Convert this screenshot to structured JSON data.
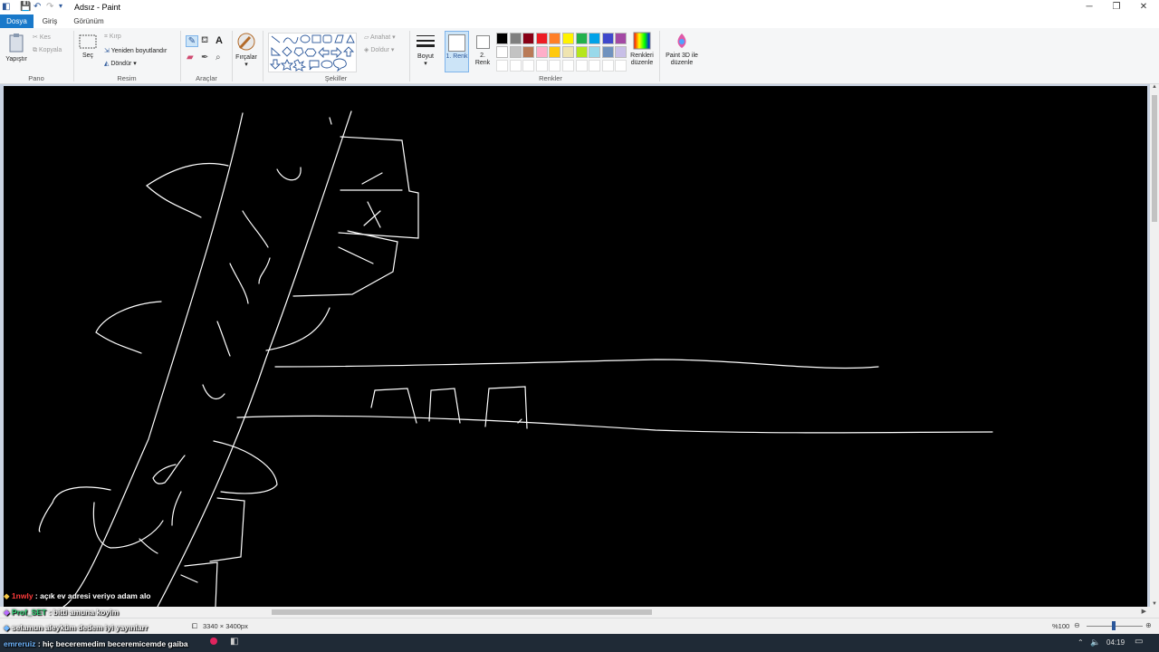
{
  "window": {
    "title": "Adsız - Paint"
  },
  "tabs": [
    {
      "label": "Dosya",
      "active": true
    },
    {
      "label": "Giriş",
      "active": false
    },
    {
      "label": "Görünüm",
      "active": false
    }
  ],
  "ribbon": {
    "pano": {
      "label": "Pano",
      "paste": "Yapıştır",
      "cut": "Kes",
      "copy": "Kopyala"
    },
    "resim": {
      "label": "Resim",
      "select": "Seç",
      "crop": "Kırp",
      "resize": "Yeniden boyutlandır",
      "rotate": "Döndür"
    },
    "araclar": {
      "label": "Araçlar"
    },
    "brushes": "Fırçalar",
    "sekiller": {
      "label": "Şekiller",
      "outline": "Anahat",
      "fill": "Doldur"
    },
    "size": "Boyut",
    "color1": "1. Renk",
    "color2": "2. Renk",
    "renkler": {
      "label": "Renkler",
      "edit_colors": "Renkleri düzenle",
      "paint3d": "Paint 3D ile düzenle",
      "palette_row1": [
        "#000000",
        "#7f7f7f",
        "#880015",
        "#ed1c24",
        "#ff7f27",
        "#fff200",
        "#22b14c",
        "#00a2e8",
        "#3f48cc",
        "#a349a4"
      ],
      "palette_row2": [
        "#ffffff",
        "#c3c3c3",
        "#b97a57",
        "#ffaec9",
        "#ffc90e",
        "#efe4b0",
        "#b5e61d",
        "#99d9ea",
        "#7092be",
        "#c8bfe7"
      ]
    }
  },
  "status": {
    "canvas_size": "3340 × 3400px",
    "zoom": "%100"
  },
  "chat": [
    {
      "user": "1nwly",
      "message": ": açık ev adresi veriyo adam alo"
    },
    {
      "user": "Prof_SET",
      "message": ": bitti amuna koyim"
    },
    {
      "user": "",
      "message": "selamun aleyküm dedem iyi yayınlarr"
    },
    {
      "user": "emreruiz",
      "message": ": hiç beceremedim beceremicemde gaiba"
    }
  ],
  "taskbar": {
    "clock": "04:19"
  }
}
